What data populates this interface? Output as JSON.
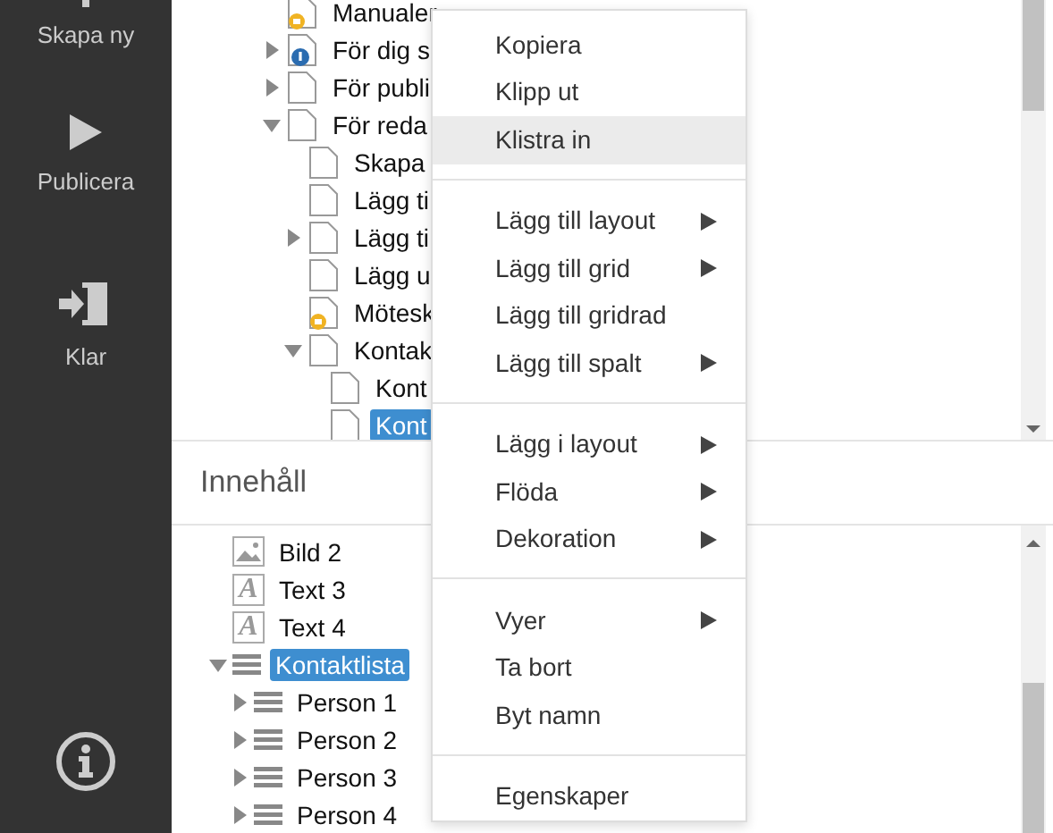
{
  "sidebar": {
    "items": [
      {
        "kind": "plus",
        "label": "Skapa ny"
      },
      {
        "kind": "play",
        "label": "Publicera"
      },
      {
        "kind": "exit",
        "label": "Klar"
      }
    ]
  },
  "page_tree": {
    "items": [
      {
        "label": "Manualer",
        "kind": "locked",
        "selected": false
      },
      {
        "label": "För dig s",
        "kind": "info",
        "expanded": false,
        "selected": false
      },
      {
        "label": "För publi",
        "kind": "page",
        "expanded": false,
        "selected": false
      },
      {
        "label": "För reda",
        "kind": "page",
        "expanded": true,
        "selected": false,
        "children": [
          {
            "label": "Skapa",
            "kind": "page",
            "selected": false
          },
          {
            "label": "Lägg ti",
            "kind": "page",
            "selected": false
          },
          {
            "label": "Lägg ti",
            "kind": "page",
            "expanded": false,
            "selected": false
          },
          {
            "label": "Lägg u",
            "kind": "page",
            "selected": false
          },
          {
            "label": "Mötesk",
            "kind": "locked",
            "selected": false
          },
          {
            "label": "Kontak",
            "kind": "page",
            "expanded": true,
            "selected": false,
            "children": [
              {
                "label": "Kont",
                "kind": "page",
                "selected": false
              },
              {
                "label": "Kont",
                "kind": "page",
                "selected": true
              }
            ]
          }
        ]
      }
    ]
  },
  "content_header": "Innehåll",
  "content_tree": {
    "items": [
      {
        "label": "Bild 2",
        "kind": "image",
        "selected": false
      },
      {
        "label": "Text 3",
        "kind": "text",
        "glyph": "A",
        "selected": false
      },
      {
        "label": "Text 4",
        "kind": "text",
        "glyph": "A",
        "selected": false
      },
      {
        "label": "Kontaktlista",
        "kind": "list",
        "expanded": true,
        "selected": true,
        "children": [
          {
            "label": "Person 1",
            "kind": "list",
            "expanded": false,
            "selected": false
          },
          {
            "label": "Person 2",
            "kind": "list",
            "expanded": false,
            "selected": false
          },
          {
            "label": "Person 3",
            "kind": "list",
            "expanded": false,
            "selected": false
          },
          {
            "label": "Person 4",
            "kind": "list",
            "expanded": false,
            "selected": false
          }
        ]
      }
    ]
  },
  "context_menu": {
    "groups": [
      [
        {
          "label": "Kopiera",
          "submenu": false,
          "highlighted": false
        },
        {
          "label": "Klipp ut",
          "submenu": false,
          "highlighted": false
        },
        {
          "label": "Klistra in",
          "submenu": false,
          "highlighted": true
        }
      ],
      [
        {
          "label": "Lägg till layout",
          "submenu": true,
          "highlighted": false
        },
        {
          "label": "Lägg till grid",
          "submenu": true,
          "highlighted": false
        },
        {
          "label": "Lägg till gridrad",
          "submenu": false,
          "highlighted": false
        },
        {
          "label": "Lägg till spalt",
          "submenu": true,
          "highlighted": false
        }
      ],
      [
        {
          "label": "Lägg i layout",
          "submenu": true,
          "highlighted": false
        },
        {
          "label": "Flöda",
          "submenu": true,
          "highlighted": false
        },
        {
          "label": "Dekoration",
          "submenu": true,
          "highlighted": false
        }
      ],
      [
        {
          "label": "Vyer",
          "submenu": true,
          "highlighted": false
        },
        {
          "label": "Ta bort",
          "submenu": false,
          "highlighted": false
        },
        {
          "label": "Byt namn",
          "submenu": false,
          "highlighted": false
        }
      ],
      [
        {
          "label": "Egenskaper",
          "submenu": false,
          "highlighted": false
        }
      ]
    ]
  }
}
